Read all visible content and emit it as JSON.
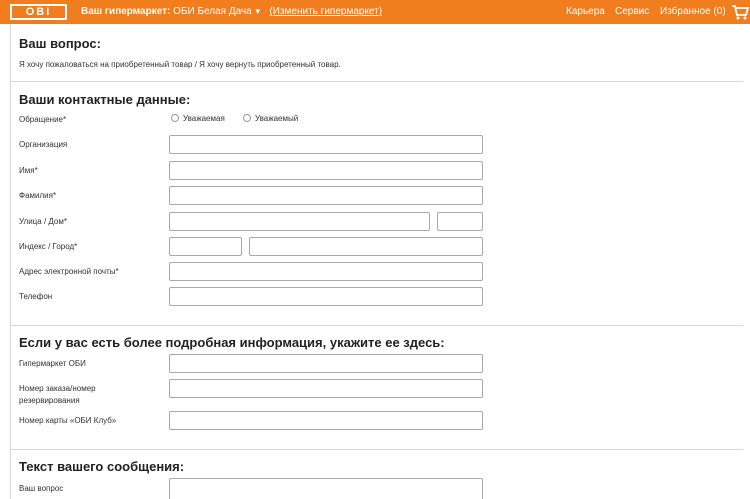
{
  "header": {
    "logo_text": "OBI",
    "store_label": "Ваш гипермаркет:",
    "store_name": "ОБИ Белая Дача",
    "change_store_link": "(Изменить гипермаркет)",
    "nav": [
      "Карьера",
      "Сервис",
      "Избранное (0)"
    ],
    "brand_color": "#f07d1e"
  },
  "question_section": {
    "title": "Ваш вопрос:",
    "selected_topic": "Я хочу пожаловаться на приобретенный товар / Я хочу вернуть приобретенный товар."
  },
  "contact_section": {
    "title": "Ваши контактные данные:",
    "salutation_label": "Обращение*",
    "salutation_options": [
      "Уважаемая",
      "Уважаемый"
    ],
    "organization_label": "Организация",
    "first_name_label": "Имя*",
    "last_name_label": "Фамилия*",
    "street_label": "Улица / Дом*",
    "zip_city_label": "Индекс / Город*",
    "email_label": "Адрес электронной почты*",
    "phone_label": "Телефон"
  },
  "details_section": {
    "title": "Если у вас есть более подробная информация, укажите ее здесь:",
    "store_label": "Гипермаркет ОБИ",
    "order_label": "Номер заказа/номер резервирования",
    "card_label": "Номер карты «ОБИ Клуб»"
  },
  "message_section": {
    "title": "Текст вашего сообщения:",
    "question_label": "Ваш вопрос"
  }
}
